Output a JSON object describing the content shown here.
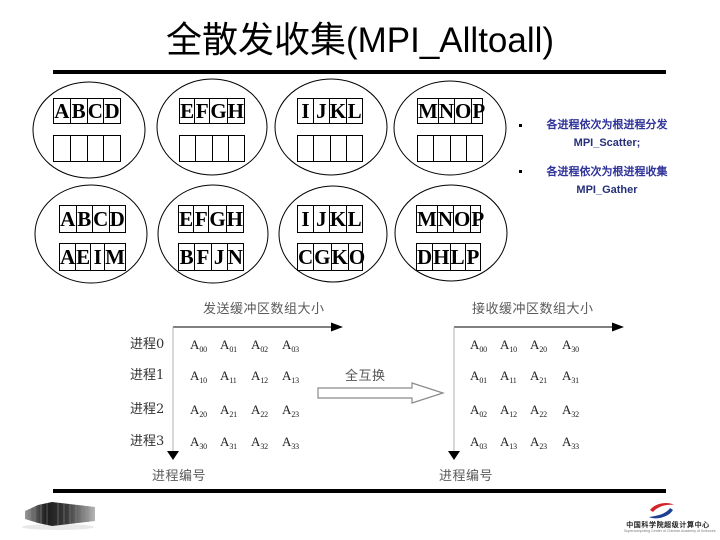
{
  "title": {
    "cjk": "全散发收集",
    "latin": "(MPI_Alltoall)"
  },
  "before": {
    "processes": [
      {
        "send": [
          "A",
          "B",
          "C",
          "D"
        ],
        "recv": [
          "",
          "",
          "",
          ""
        ]
      },
      {
        "send": [
          "E",
          "F",
          "G",
          "H"
        ],
        "recv": [
          "",
          "",
          "",
          ""
        ]
      },
      {
        "send": [
          "I",
          "J",
          "K",
          "L"
        ],
        "recv": [
          "",
          "",
          "",
          ""
        ]
      },
      {
        "send": [
          "M",
          "N",
          "O",
          "P"
        ],
        "recv": [
          "",
          "",
          "",
          ""
        ]
      }
    ]
  },
  "after": {
    "processes": [
      {
        "send": [
          "A",
          "B",
          "C",
          "D"
        ],
        "recv": [
          "A",
          "E",
          "I",
          "M"
        ]
      },
      {
        "send": [
          "E",
          "F",
          "G",
          "H"
        ],
        "recv": [
          "B",
          "F",
          "J",
          "N"
        ]
      },
      {
        "send": [
          "I",
          "J",
          "K",
          "L"
        ],
        "recv": [
          "C",
          "G",
          "K",
          "O"
        ]
      },
      {
        "send": [
          "M",
          "N",
          "O",
          "P"
        ],
        "recv": [
          "D",
          "H",
          "L",
          "P"
        ]
      }
    ]
  },
  "bullets": [
    {
      "text": "各进程依次为根进程分发",
      "api": "MPI_Scatter;"
    },
    {
      "text": "各进程依次为根进程收集",
      "api": "MPI_Gather"
    }
  ],
  "diagram": {
    "send_axis_label": "发送缓冲区数组大小",
    "recv_axis_label": "接收缓冲区数组大小",
    "process_axis_label": "进程编号",
    "exchange_label": "全互换",
    "row_labels": [
      "进程0",
      "进程1",
      "进程2",
      "进程3"
    ],
    "cell_base": "A",
    "send_matrix": [
      [
        "00",
        "01",
        "02",
        "03"
      ],
      [
        "10",
        "11",
        "12",
        "13"
      ],
      [
        "20",
        "21",
        "22",
        "23"
      ],
      [
        "30",
        "31",
        "32",
        "33"
      ]
    ],
    "recv_matrix": [
      [
        "00",
        "10",
        "20",
        "30"
      ],
      [
        "01",
        "11",
        "21",
        "31"
      ],
      [
        "02",
        "12",
        "22",
        "32"
      ],
      [
        "03",
        "13",
        "23",
        "33"
      ]
    ]
  },
  "footer": {
    "logo_name": "中国科学院超级计算中心",
    "logo_subtitle": "Supercomputing Center of Chinese Academy of Sciences"
  }
}
